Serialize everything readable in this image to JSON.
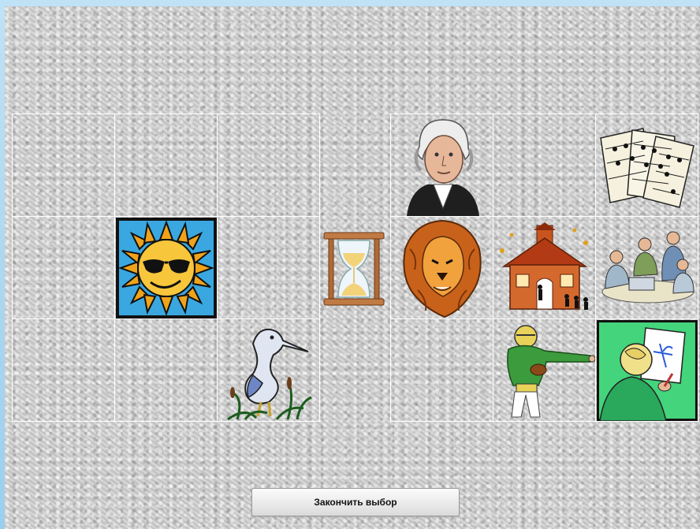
{
  "left_grid": {
    "cells": [
      {
        "icon": null
      },
      {
        "icon": null
      },
      {
        "icon": null
      },
      {
        "icon": "sun-with-sunglasses-icon"
      },
      {
        "icon": null
      },
      {
        "icon": null
      },
      {
        "icon": null
      },
      {
        "icon": null
      },
      {
        "icon": "heron-icon"
      }
    ]
  },
  "center": {
    "icon": "hourglass-icon"
  },
  "right_grid": {
    "cells": [
      {
        "icon": "george-washington-portrait-icon"
      },
      {
        "icon": null
      },
      {
        "icon": "sheet-music-icon"
      },
      {
        "icon": "lion-icon"
      },
      {
        "icon": "schoolhouse-icon"
      },
      {
        "icon": "business-meeting-icon"
      },
      {
        "icon": null
      },
      {
        "icon": "football-player-icon"
      },
      {
        "icon": "child-drawing-icon"
      }
    ]
  },
  "finish_button": {
    "label": "Закончить выбор"
  },
  "colors": {
    "cell_border": "#ffffff",
    "panel": "#cfcfcf",
    "page_bg": "#a9d6ef"
  }
}
